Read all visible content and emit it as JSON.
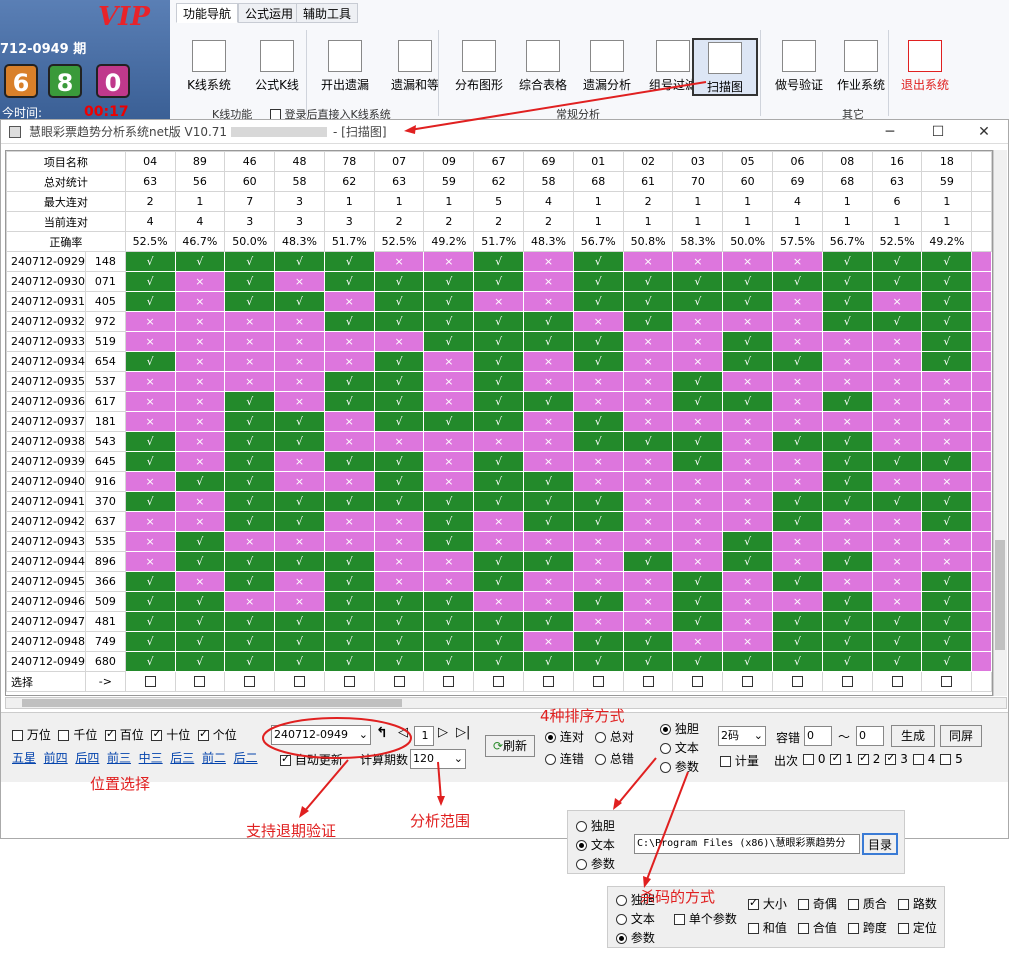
{
  "header": {
    "vip": "VIP",
    "period": "712-0949 期",
    "balls": [
      "6",
      "8",
      "0"
    ],
    "ball_colors": [
      "#d9802a",
      "#3a9a3a",
      "#c0398c"
    ],
    "countdown_label": "今时间:",
    "countdown": "00:17"
  },
  "ribbon": {
    "tabs": [
      "功能导航",
      "公式运用",
      "辅助工具"
    ],
    "buttons": [
      "K线系统",
      "公式K线",
      "开出遗漏",
      "遗漏和等",
      "分布图形",
      "综合表格",
      "遗漏分析",
      "组号过滤",
      "扫描图",
      "做号验证",
      "作业系统",
      "退出系统"
    ],
    "groups": [
      "K线功能",
      "登录后直接入K线系统",
      "常规分析",
      "其它"
    ]
  },
  "window": {
    "title": "慧眼彩票趋势分析系统net版 V10.71",
    "title_suffix": "- [扫描图]"
  },
  "grid": {
    "stat_labels": [
      "项目名称",
      "总对统计",
      "最大连对",
      "当前连对",
      "正确率"
    ],
    "columns": [
      "04",
      "89",
      "46",
      "48",
      "78",
      "07",
      "09",
      "67",
      "69",
      "01",
      "02",
      "03",
      "05",
      "06",
      "08",
      "16",
      "18"
    ],
    "total": [
      "63",
      "56",
      "60",
      "58",
      "62",
      "63",
      "59",
      "62",
      "58",
      "68",
      "61",
      "70",
      "60",
      "69",
      "68",
      "63",
      "59"
    ],
    "max_run": [
      "2",
      "1",
      "7",
      "3",
      "1",
      "1",
      "1",
      "5",
      "4",
      "1",
      "2",
      "1",
      "1",
      "4",
      "1",
      "6",
      "1"
    ],
    "cur_run": [
      "4",
      "4",
      "3",
      "3",
      "3",
      "2",
      "2",
      "2",
      "2",
      "1",
      "1",
      "1",
      "1",
      "1",
      "1",
      "1",
      "1"
    ],
    "rate": [
      "52.5%",
      "46.7%",
      "50.0%",
      "48.3%",
      "51.7%",
      "52.5%",
      "49.2%",
      "51.7%",
      "48.3%",
      "56.7%",
      "50.8%",
      "58.3%",
      "50.0%",
      "57.5%",
      "56.7%",
      "52.5%",
      "49.2%"
    ],
    "rows": [
      {
        "id": "240712-0929",
        "num": "148",
        "cells": "GGGGGPPGPGPPPPGGG"
      },
      {
        "id": "240712-0930",
        "num": "071",
        "cells": "GPGPGGGGPGGGGGGGG"
      },
      {
        "id": "240712-0931",
        "num": "405",
        "cells": "GPGGPGGPPGGGGPGPG"
      },
      {
        "id": "240712-0932",
        "num": "972",
        "cells": "PPPPGGGGGPGPPPGGG"
      },
      {
        "id": "240712-0933",
        "num": "519",
        "cells": "PPPPPPGGGGPPGPPPG"
      },
      {
        "id": "240712-0934",
        "num": "654",
        "cells": "GPPPPGPGPGPPGGPPG"
      },
      {
        "id": "240712-0935",
        "num": "537",
        "cells": "PPPPGGPGPPPGPPPPP"
      },
      {
        "id": "240712-0936",
        "num": "617",
        "cells": "PPGPGGPGGPPGGPGPP"
      },
      {
        "id": "240712-0937",
        "num": "181",
        "cells": "PPGGPGGGPGPPPPPPP"
      },
      {
        "id": "240712-0938",
        "num": "543",
        "cells": "GPGGPPPPPGGGPGGPP"
      },
      {
        "id": "240712-0939",
        "num": "645",
        "cells": "GPGPGGPGPPPGPPGGG"
      },
      {
        "id": "240712-0940",
        "num": "916",
        "cells": "PGGPPGPGGPPPPPGPP"
      },
      {
        "id": "240712-0941",
        "num": "370",
        "cells": "GPGGGGGGGGPPPGGGG"
      },
      {
        "id": "240712-0942",
        "num": "637",
        "cells": "PPGGPPGPGGPPPGPPG"
      },
      {
        "id": "240712-0943",
        "num": "535",
        "cells": "PGPPPPGPPPPPGPPPP"
      },
      {
        "id": "240712-0944",
        "num": "896",
        "cells": "PGGGGPPGGPGPGPGPP"
      },
      {
        "id": "240712-0945",
        "num": "366",
        "cells": "GPGPGPPGPPPGPGPPG"
      },
      {
        "id": "240712-0946",
        "num": "509",
        "cells": "GGPPGGGPPGPGPPGPG"
      },
      {
        "id": "240712-0947",
        "num": "481",
        "cells": "GGGGGGGGGPPGPGGGG"
      },
      {
        "id": "240712-0948",
        "num": "749",
        "cells": "GGGGGGGGPGGPPGGGG"
      },
      {
        "id": "240712-0949",
        "num": "680",
        "cells": "GGGGGGGGGGGGGGGGG"
      }
    ],
    "select_label": "选择",
    "select_arrow": "->",
    "yes": "√",
    "no": "×"
  },
  "controls": {
    "positions": [
      "万位",
      "千位",
      "百位",
      "十位",
      "个位"
    ],
    "position_checked": [
      false,
      false,
      true,
      true,
      true
    ],
    "links": [
      "五星",
      "前四",
      "后四",
      "前三",
      "中三",
      "后三",
      "前二",
      "后二"
    ],
    "period_select": "240712-0949",
    "page_num": "1",
    "auto_update": "自动更新",
    "calc_label": "计算期数",
    "calc_value": "120",
    "refresh": "刷新",
    "sort": [
      "连对",
      "总对",
      "连错",
      "总错"
    ],
    "mode": [
      "独胆",
      "文本",
      "参数"
    ],
    "code_select": "2码",
    "tolerance": "容错",
    "tol_a": "0",
    "tol_b": "0",
    "tilde": "～",
    "generate": "生成",
    "same_screen": "同屏",
    "count_label": "计量",
    "appear_label": "出次",
    "appear": [
      "0",
      "1",
      "2",
      "3",
      "4",
      "5"
    ],
    "appear_checked": [
      false,
      true,
      true,
      true,
      false,
      false
    ]
  },
  "annotations": {
    "window_arrow": "",
    "pos_select": "位置选择",
    "sort_ways": "4种排序方式",
    "retreat": "支持退期验证",
    "range": "分析范围",
    "kill": "杀码的方式"
  },
  "popup_text": {
    "mode": [
      "独胆",
      "文本",
      "参数"
    ],
    "path": "C:\\Program Files (x86)\\慧眼彩票趋势分",
    "dir_btn": "目录"
  },
  "popup_param": {
    "mode": [
      "独胆",
      "文本",
      "参数"
    ],
    "single": "单个参数",
    "opts": [
      "大小",
      "奇偶",
      "质合",
      "路数",
      "和值",
      "合值",
      "跨度",
      "定位"
    ],
    "opts_checked": [
      true,
      false,
      false,
      false,
      false,
      false,
      false,
      false
    ]
  }
}
